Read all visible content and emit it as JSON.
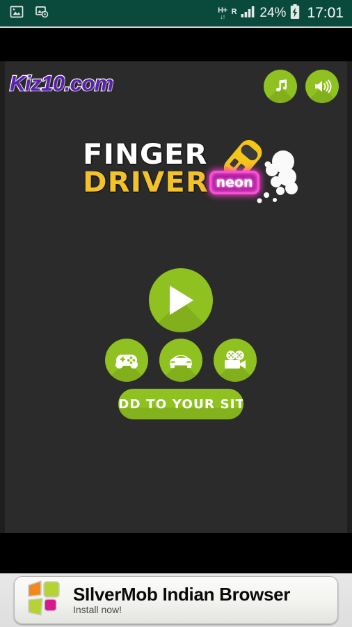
{
  "statusbar": {
    "notification_icons": [
      "screenshot-image-icon",
      "settings-image-icon"
    ],
    "network_type": "H+",
    "roaming": "R",
    "battery_percent": "24%",
    "time": "17:01",
    "background_color": "#0a4a3c"
  },
  "header": {
    "site_logo": "Kiz10.com",
    "site_logo_color": "#5b1fb5",
    "music_button_label": "Music",
    "sound_button_label": "Sound"
  },
  "game_logo": {
    "line1": "FINGER",
    "line2": "DRIVER",
    "badge": "neon",
    "line1_color": "#ffffff",
    "line2_color": "#f3c12a",
    "badge_color": "#ff4fd8"
  },
  "actions": {
    "play_label": "Play",
    "categories": [
      {
        "name": "gamepad-icon",
        "label": "More Games"
      },
      {
        "name": "car-icon",
        "label": "Car Games"
      },
      {
        "name": "movie-camera-icon",
        "label": "Videos"
      }
    ],
    "add_to_site_label": "ADD TO YOUR SITE",
    "accent_color": "#8fc220"
  },
  "ad": {
    "title": "SIlverMob Indian Browser",
    "subtitle": "Install now!",
    "logo_colors": [
      "#f08a1e",
      "#b5d334",
      "#d61a8c"
    ]
  }
}
